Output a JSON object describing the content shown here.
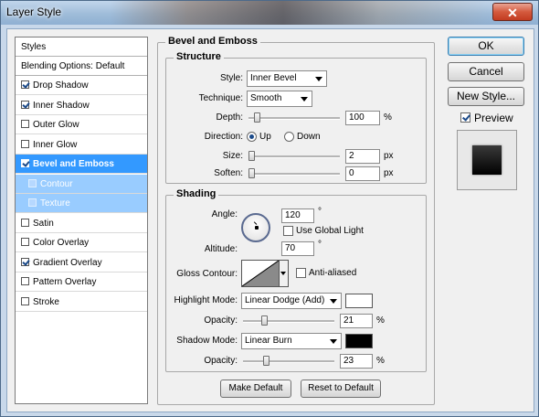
{
  "window": {
    "title": "Layer Style",
    "close_glyph": "✕"
  },
  "styles_panel": {
    "header": "Styles",
    "blending": "Blending Options: Default",
    "items": [
      {
        "label": "Drop Shadow",
        "checked": true
      },
      {
        "label": "Inner Shadow",
        "checked": true
      },
      {
        "label": "Outer Glow",
        "checked": false
      },
      {
        "label": "Inner Glow",
        "checked": false
      },
      {
        "label": "Bevel and Emboss",
        "checked": true,
        "selected": true
      },
      {
        "label": "Contour",
        "checked": false,
        "sub": true
      },
      {
        "label": "Texture",
        "checked": false,
        "sub": true
      },
      {
        "label": "Satin",
        "checked": false
      },
      {
        "label": "Color Overlay",
        "checked": false
      },
      {
        "label": "Gradient Overlay",
        "checked": true
      },
      {
        "label": "Pattern Overlay",
        "checked": false
      },
      {
        "label": "Stroke",
        "checked": false
      }
    ]
  },
  "bevel": {
    "section_title": "Bevel and Emboss",
    "structure": {
      "title": "Structure",
      "style_label": "Style:",
      "style_value": "Inner Bevel",
      "technique_label": "Technique:",
      "technique_value": "Smooth",
      "depth_label": "Depth:",
      "depth_value": "100",
      "depth_unit": "%",
      "direction_label": "Direction:",
      "dir_up": "Up",
      "dir_down": "Down",
      "direction_selected": "Up",
      "size_label": "Size:",
      "size_value": "2",
      "size_unit": "px",
      "soften_label": "Soften:",
      "soften_value": "0",
      "soften_unit": "px"
    },
    "shading": {
      "title": "Shading",
      "angle_label": "Angle:",
      "angle_value": "120",
      "angle_unit": "°",
      "global_light_label": "Use Global Light",
      "global_light_checked": false,
      "altitude_label": "Altitude:",
      "altitude_value": "70",
      "altitude_unit": "°",
      "gloss_label": "Gloss Contour:",
      "anti_aliased_label": "Anti-aliased",
      "anti_aliased_checked": false,
      "highlight_mode_label": "Highlight Mode:",
      "highlight_mode_value": "Linear Dodge (Add)",
      "highlight_color": "#ffffff",
      "highlight_opacity_label": "Opacity:",
      "highlight_opacity_value": "21",
      "highlight_opacity_unit": "%",
      "shadow_mode_label": "Shadow Mode:",
      "shadow_mode_value": "Linear Burn",
      "shadow_color": "#000000",
      "shadow_opacity_label": "Opacity:",
      "shadow_opacity_value": "23",
      "shadow_opacity_unit": "%"
    },
    "make_default": "Make Default",
    "reset_default": "Reset to Default"
  },
  "actions": {
    "ok": "OK",
    "cancel": "Cancel",
    "new_style": "New Style...",
    "preview_label": "Preview",
    "preview_checked": true
  }
}
